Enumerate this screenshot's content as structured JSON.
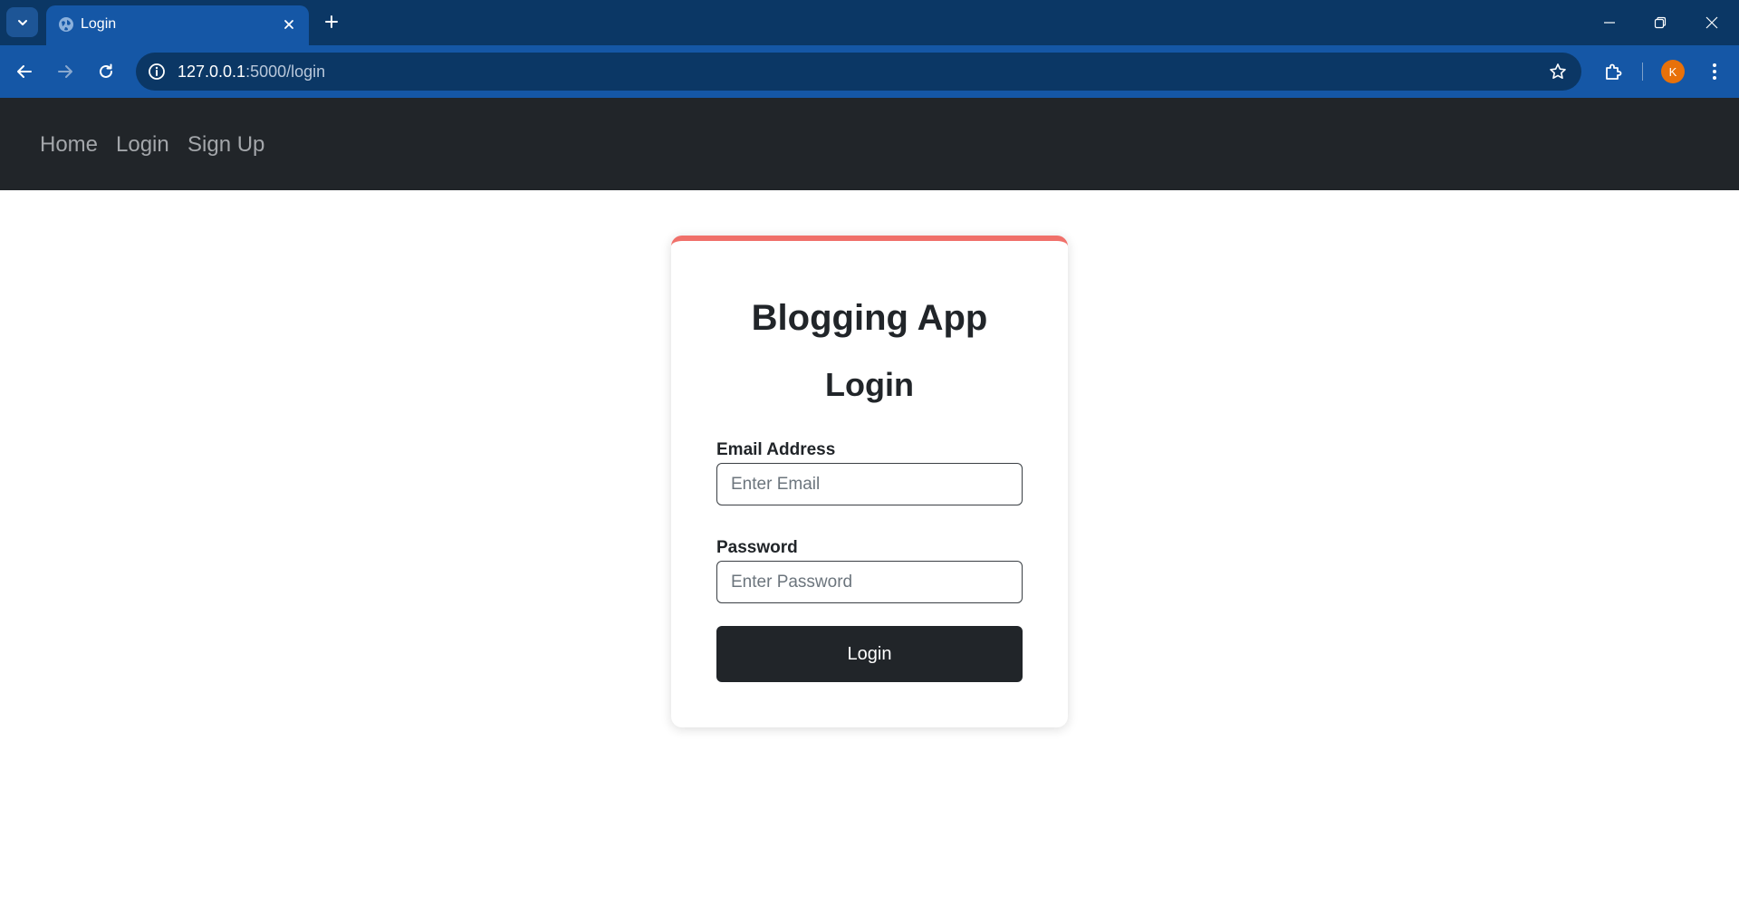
{
  "browser": {
    "tab": {
      "title": "Login"
    },
    "address_bar": {
      "url_host": "127.0.0.1",
      "url_path": ":5000/login"
    },
    "profile_initial": "K",
    "colors": {
      "tabstrip": "#0b3765",
      "toolbar": "#1557a6",
      "profile": "#e8710a"
    }
  },
  "navbar": {
    "links": [
      {
        "label": "Home"
      },
      {
        "label": "Login"
      },
      {
        "label": "Sign Up"
      }
    ]
  },
  "card": {
    "app_title": "Blogging App",
    "form_title": "Login",
    "email": {
      "label": "Email Address",
      "placeholder": "Enter Email",
      "value": ""
    },
    "password": {
      "label": "Password",
      "placeholder": "Enter Password",
      "value": ""
    },
    "submit_label": "Login",
    "accent_color": "#f0706a"
  }
}
